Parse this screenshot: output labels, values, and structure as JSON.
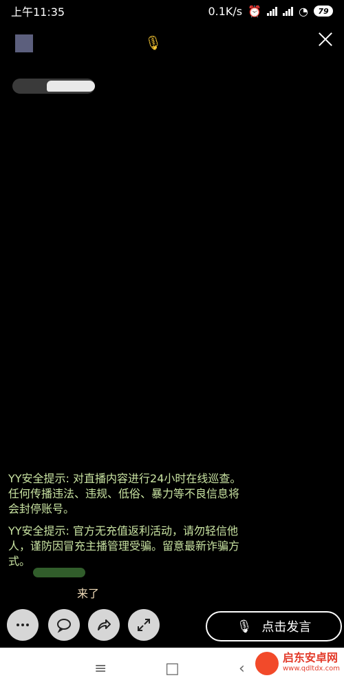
{
  "status_bar": {
    "time": "上午11:35",
    "net_speed": "0.1K/s",
    "battery": "79",
    "icons": [
      "alarm-off-icon",
      "signal-icon",
      "signal-icon",
      "wifi-icon",
      "battery-icon"
    ]
  },
  "top_bar": {
    "icons": [
      "avatar",
      "mic-people-icon",
      "close-icon"
    ]
  },
  "chat": {
    "messages": [
      "YY安全提示: 对直播内容进行24小时在线巡查。任何传播违法、违规、低俗、暴力等不良信息将会封停账号。",
      "YY安全提示: 官方无充值返利活动，请勿轻信他人，谨防因冒充主播管理受骗。留意最新诈骗方式。"
    ],
    "arrival_text": "来了"
  },
  "actions": {
    "buttons": [
      "more-icon",
      "chat-bubble-icon",
      "share-icon",
      "expand-icon"
    ],
    "speak_label": "点击发言",
    "speak_icon": "mic-icon"
  },
  "nav": {
    "icons": [
      "menu-icon",
      "home-square-icon",
      "back-icon"
    ]
  },
  "watermark": {
    "title": "启东安卓网",
    "url": "www.qdltdx.com"
  },
  "colors": {
    "chat_text": "#c9e3a2",
    "accent": "#f1c232"
  }
}
